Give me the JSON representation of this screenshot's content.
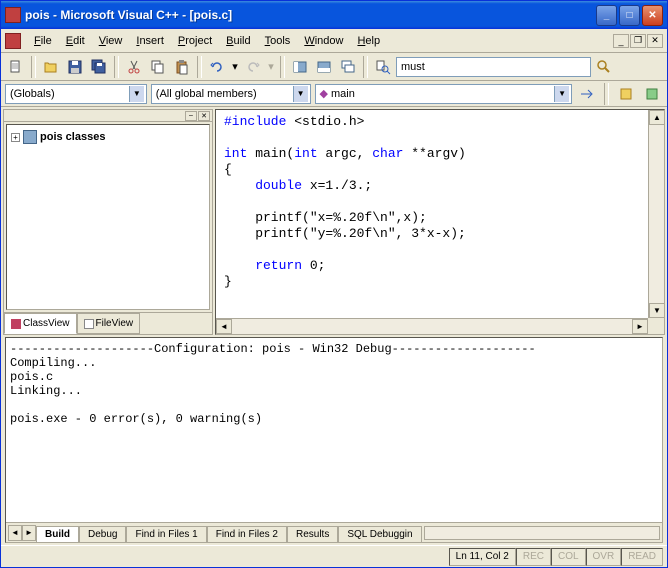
{
  "titlebar": {
    "text": "pois - Microsoft Visual C++ - [pois.c]"
  },
  "menubar": {
    "file": "File",
    "edit": "Edit",
    "view": "View",
    "insert": "Insert",
    "project": "Project",
    "build": "Build",
    "tools": "Tools",
    "window": "Window",
    "help": "Help"
  },
  "toolbar": {
    "find_value": "must"
  },
  "toolbar2": {
    "scope": "(Globals)",
    "members": "(All global members)",
    "function": "main"
  },
  "sidebar": {
    "tree_item": "pois classes",
    "tabs": {
      "classview": "ClassView",
      "fileview": "FileView"
    }
  },
  "code": {
    "line1_pre": "#include",
    "line1_post": " <stdio.h>",
    "line2a": "int",
    "line2b": " main(",
    "line2c": "int",
    "line2d": " argc, ",
    "line2e": "char",
    "line2f": " **argv)",
    "line3": "{",
    "line4a": "    double",
    "line4b": " x=1./3.;",
    "line5": "    printf(\"x=%.20f\\n\",x);",
    "line6": "    printf(\"y=%.20f\\n\", 3*x-x);",
    "line7a": "    return",
    "line7b": " 0;",
    "line8": "}"
  },
  "output": {
    "text": "--------------------Configuration: pois - Win32 Debug--------------------\nCompiling...\npois.c\nLinking...\n\npois.exe - 0 error(s), 0 warning(s)",
    "tabs": {
      "build": "Build",
      "debug": "Debug",
      "find1": "Find in Files 1",
      "find2": "Find in Files 2",
      "results": "Results",
      "sql": "SQL Debuggin"
    }
  },
  "statusbar": {
    "position": "Ln 11, Col 2",
    "rec": "REC",
    "col": "COL",
    "ovr": "OVR",
    "read": "READ"
  }
}
